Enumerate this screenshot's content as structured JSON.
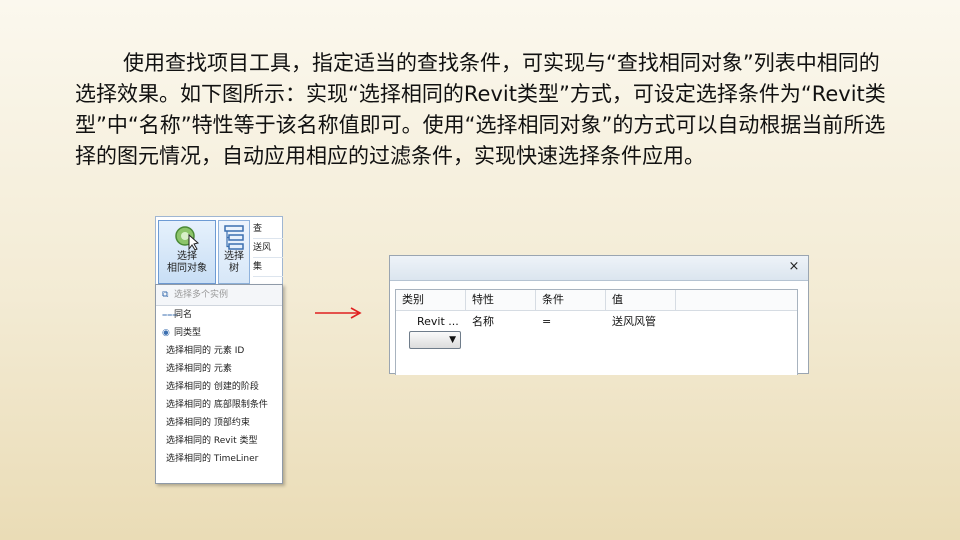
{
  "paragraph": "使用查找项目工具，指定适当的查找条件，可实现与“查找相同对象”列表中相同的选择效果。如下图所示：实现“选择相同的Revit类型”方式，可设定选择条件为“Revit类型”中“名称”特性等于该名称值即可。使用“选择相同对象”的方式可以自动根据当前所选择的图元情况，自动应用相应的过滤条件，实现快速选择条件应用。",
  "ribbon": {
    "select_same_line1": "选择",
    "select_same_line2": "相同对象",
    "select_tree_line1": "选择",
    "select_tree_line2": "树",
    "side_items": [
      "查",
      "送风",
      "集"
    ]
  },
  "menu": {
    "header": "选择多个实例",
    "items": [
      "同名",
      "同类型",
      "选择相同的 元素 ID",
      "选择相同的 元素",
      "选择相同的 创建的阶段",
      "选择相同的 底部限制条件",
      "选择相同的 顶部约束",
      "选择相同的 Revit 类型",
      "选择相同的 TimeLiner"
    ]
  },
  "dialog": {
    "close_label": "×",
    "columns": [
      "类别",
      "特性",
      "条件",
      "值"
    ],
    "row": {
      "category": "Revit ...",
      "property": "名称",
      "condition": "=",
      "value": "送风风管"
    }
  },
  "colors": {
    "arrow": "#e02020",
    "ribbon_accent": "#6d9bd4"
  }
}
